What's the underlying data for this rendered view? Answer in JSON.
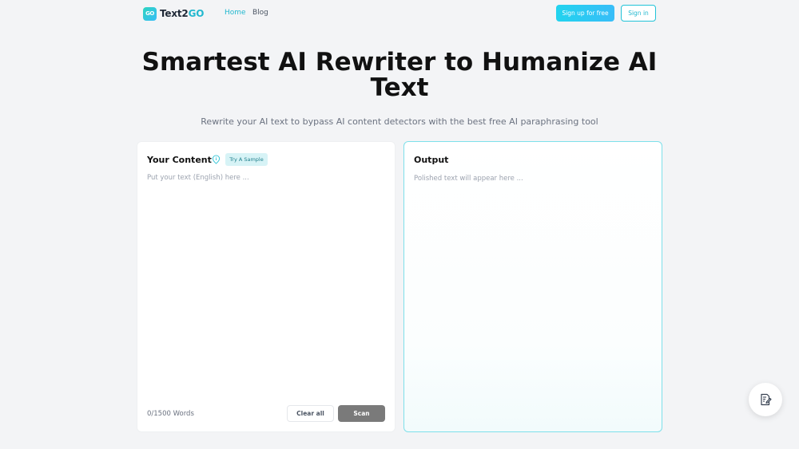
{
  "brand": {
    "logo_mark": "GO",
    "name_main": "Text2",
    "name_accent": "GO",
    "accent_color": "#22b8cf"
  },
  "nav": {
    "links": [
      {
        "label": "Home",
        "active": true
      },
      {
        "label": "Blog",
        "active": false
      }
    ],
    "signup_label": "Sign up for free",
    "signin_label": "Sign in"
  },
  "hero": {
    "title": "Smartest AI Rewriter to Humanize AI Text",
    "subtitle": "Rewrite your AI text to bypass AI content detectors with the best free AI paraphrasing tool"
  },
  "input_panel": {
    "title": "Your Content",
    "info_icon": "info-pin-icon",
    "sample_label": "Try A Sample",
    "placeholder": "Put your text (English) here ...",
    "value": "",
    "word_count": "0/1500 Words",
    "clear_label": "Clear all",
    "scan_label": "Scan"
  },
  "output_panel": {
    "title": "Output",
    "placeholder": "Polished text will appear here ..."
  },
  "fab": {
    "icon": "document-edit-icon"
  }
}
